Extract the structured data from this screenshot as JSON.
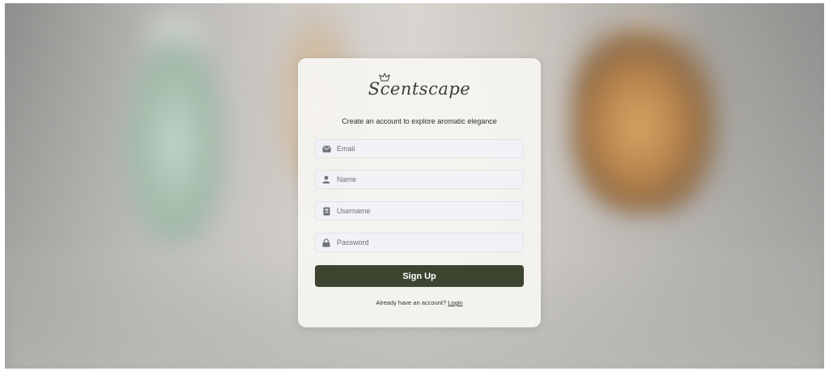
{
  "brand": {
    "name": "Scentscape",
    "logo_icon": "perfume-crown-icon"
  },
  "form": {
    "subtitle": "Create an account to explore aromatic elegance",
    "fields": [
      {
        "name": "email",
        "icon": "envelope-icon",
        "placeholder": "Email",
        "value": ""
      },
      {
        "name": "name",
        "icon": "user-icon",
        "placeholder": "Name",
        "value": ""
      },
      {
        "name": "username",
        "icon": "id-card-icon",
        "placeholder": "Username",
        "value": ""
      },
      {
        "name": "password",
        "icon": "lock-icon",
        "placeholder": "Password",
        "value": ""
      }
    ],
    "submit_label": "Sign Up",
    "login_prompt": "Already have an account?",
    "login_link": "Login"
  },
  "colors": {
    "button": "#3d4530",
    "field_bg": "#f1f2f5",
    "card_bg": "#f6f5f2"
  }
}
